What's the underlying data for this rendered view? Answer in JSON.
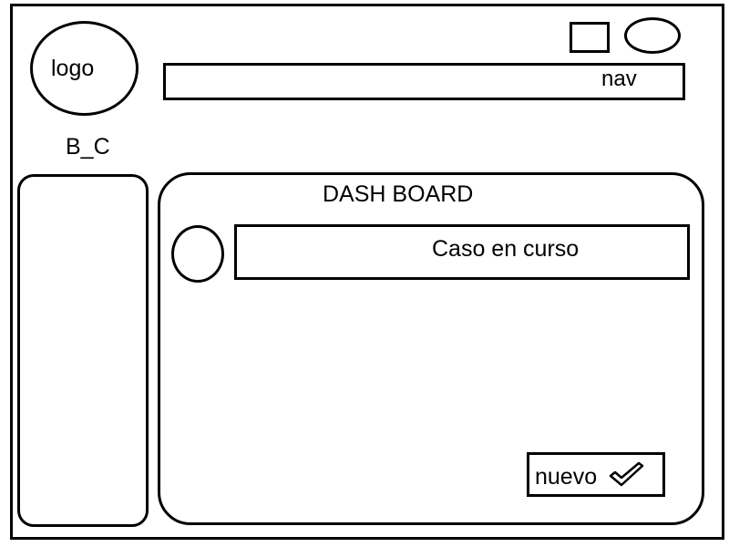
{
  "header": {
    "logo_text": "logo",
    "brand": "B_C",
    "nav_label": "nav",
    "icons": [
      "square-icon",
      "oval-icon"
    ]
  },
  "main": {
    "title": "DASH BOARD",
    "case_label": "Caso en curso",
    "new_button_label": "nuevo",
    "new_button_icon": "checkmark-icon"
  }
}
